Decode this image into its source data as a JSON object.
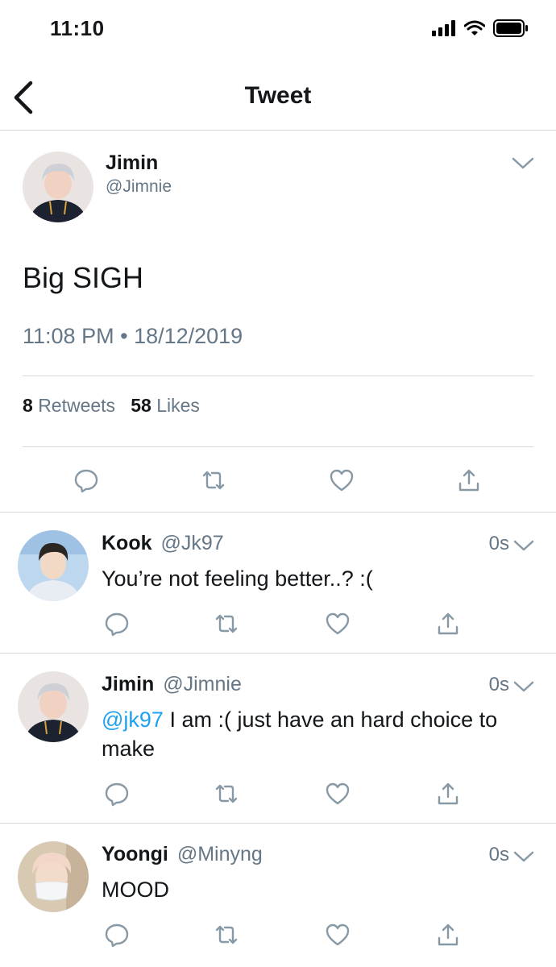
{
  "status": {
    "time": "11:10"
  },
  "nav": {
    "title": "Tweet"
  },
  "main_tweet": {
    "name": "Jimin",
    "handle": "@Jimnie",
    "text": "Big SIGH",
    "time": "11:08 PM",
    "separator": "•",
    "date": "18/12/2019",
    "retweets_count": "8",
    "retweets_label": "Retweets",
    "likes_count": "58",
    "likes_label": "Likes"
  },
  "replies": [
    {
      "name": "Kook",
      "handle": "@Jk97",
      "time": "0s",
      "text": "You’re not feeling better..? :("
    },
    {
      "name": "Jimin",
      "handle": "@Jimnie",
      "time": "0s",
      "mention": "@jk97",
      "text": " I am :( just have an hard choice to make"
    },
    {
      "name": "Yoongi",
      "handle": "@Minyng",
      "time": "0s",
      "text": "MOOD"
    }
  ],
  "colors": {
    "accent": "#1da1f2",
    "secondary_text": "#657786",
    "divider": "#d6d9db",
    "icon": "#8899a6"
  },
  "icons": [
    "back-arrow-icon",
    "chevron-down-icon",
    "reply-icon",
    "retweet-icon",
    "like-icon",
    "share-icon",
    "signal-icon",
    "wifi-icon",
    "battery-icon"
  ]
}
